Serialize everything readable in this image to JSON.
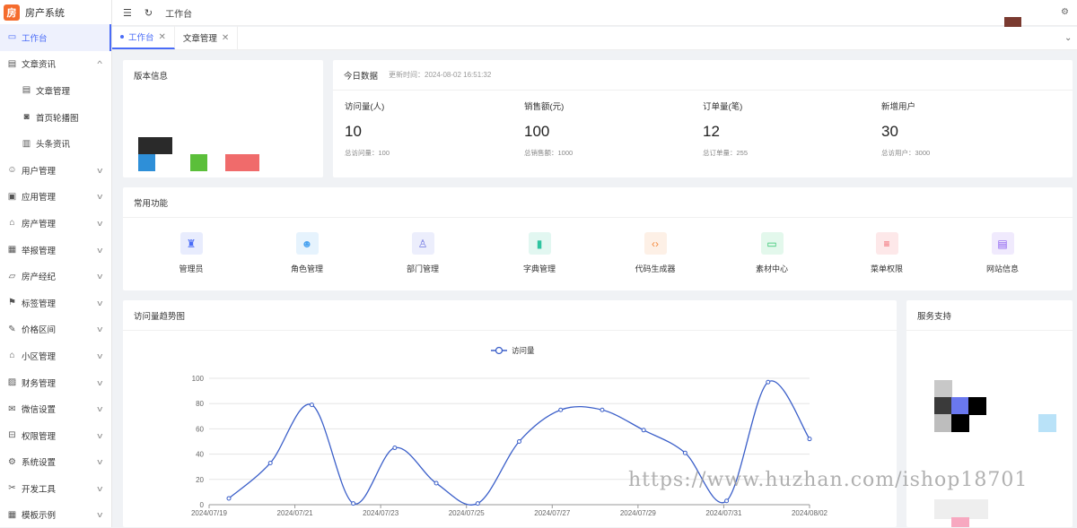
{
  "app": {
    "title": "房产系统",
    "logo_glyph": "房"
  },
  "topbar": {
    "breadcrumb": "工作台"
  },
  "tabs": [
    {
      "label": "工作台",
      "active": true
    },
    {
      "label": "文章管理",
      "active": false
    }
  ],
  "sidebar": {
    "items": [
      {
        "label": "工作台",
        "icon": "monitor-icon",
        "active": true
      },
      {
        "label": "文章资讯",
        "icon": "message-icon",
        "expanded": true
      },
      {
        "label": "文章管理",
        "icon": "message-icon",
        "sub": true
      },
      {
        "label": "首页轮播图",
        "icon": "camera-icon",
        "sub": true
      },
      {
        "label": "头条资讯",
        "icon": "book-icon",
        "sub": true
      },
      {
        "label": "用户管理",
        "icon": "user-icon"
      },
      {
        "label": "应用管理",
        "icon": "app-icon"
      },
      {
        "label": "房产管理",
        "icon": "house-icon"
      },
      {
        "label": "举报管理",
        "icon": "report-icon"
      },
      {
        "label": "房产经纪",
        "icon": "folder-icon"
      },
      {
        "label": "标签管理",
        "icon": "flag-icon"
      },
      {
        "label": "价格区间",
        "icon": "edit-icon"
      },
      {
        "label": "小区管理",
        "icon": "home-icon"
      },
      {
        "label": "财务管理",
        "icon": "chart-icon"
      },
      {
        "label": "微信设置",
        "icon": "mail-icon"
      },
      {
        "label": "权限管理",
        "icon": "lock-icon"
      },
      {
        "label": "系统设置",
        "icon": "gear-icon"
      },
      {
        "label": "开发工具",
        "icon": "wrench-icon"
      },
      {
        "label": "模板示例",
        "icon": "grid-icon"
      }
    ]
  },
  "version_card": {
    "title": "版本信息"
  },
  "today_card": {
    "title": "今日数据",
    "updated": "更新时间：2024-08-02 16:51:32",
    "stats": [
      {
        "label": "访问量(人)",
        "value": "10",
        "total": "总访问量：100"
      },
      {
        "label": "销售额(元)",
        "value": "100",
        "total": "总销售额：1000"
      },
      {
        "label": "订单量(笔)",
        "value": "12",
        "total": "总订单量：255"
      },
      {
        "label": "新增用户",
        "value": "30",
        "total": "总访用户：3000"
      }
    ]
  },
  "functions_card": {
    "title": "常用功能",
    "items": [
      {
        "label": "管理员",
        "icon": "admin-icon",
        "color": "#4a6cf7",
        "bg": "#e8ecfd"
      },
      {
        "label": "角色管理",
        "icon": "role-icon",
        "color": "#4aa3f0",
        "bg": "#e6f3fd"
      },
      {
        "label": "部门管理",
        "icon": "department-icon",
        "color": "#6b72e0",
        "bg": "#eceefc"
      },
      {
        "label": "字典管理",
        "icon": "dictionary-icon",
        "color": "#2ec4a0",
        "bg": "#e2f7f1"
      },
      {
        "label": "代码生成器",
        "icon": "code-icon",
        "color": "#f58a3d",
        "bg": "#fdf0e6"
      },
      {
        "label": "素材中心",
        "icon": "material-icon",
        "color": "#2cc36b",
        "bg": "#e3f8ec"
      },
      {
        "label": "菜单权限",
        "icon": "menu-permission-icon",
        "color": "#f0505a",
        "bg": "#fde8e9"
      },
      {
        "label": "网站信息",
        "icon": "website-icon",
        "color": "#8a5cf0",
        "bg": "#f0eafd"
      }
    ]
  },
  "chart_card": {
    "title": "访问量趋势图"
  },
  "service_card": {
    "title": "服务支持"
  },
  "watermark": "https://www.huzhan.com/ishop18701",
  "chart_data": {
    "type": "line",
    "legend": "访问量",
    "legend_position": "top-center",
    "grid": true,
    "ylim": [
      0,
      100
    ],
    "yticks": [
      0,
      20,
      40,
      60,
      80,
      100
    ],
    "x_labels": [
      "2024/07/19",
      "2024/07/21",
      "2024/07/23",
      "2024/07/25",
      "2024/07/27",
      "2024/07/29",
      "2024/07/31",
      "2024/08/02"
    ],
    "series": [
      {
        "name": "访问量",
        "color": "#3b5fc9",
        "values": [
          5,
          33,
          79,
          1,
          45,
          17,
          1,
          50,
          75,
          75,
          59,
          41,
          3,
          97,
          52
        ]
      }
    ]
  }
}
